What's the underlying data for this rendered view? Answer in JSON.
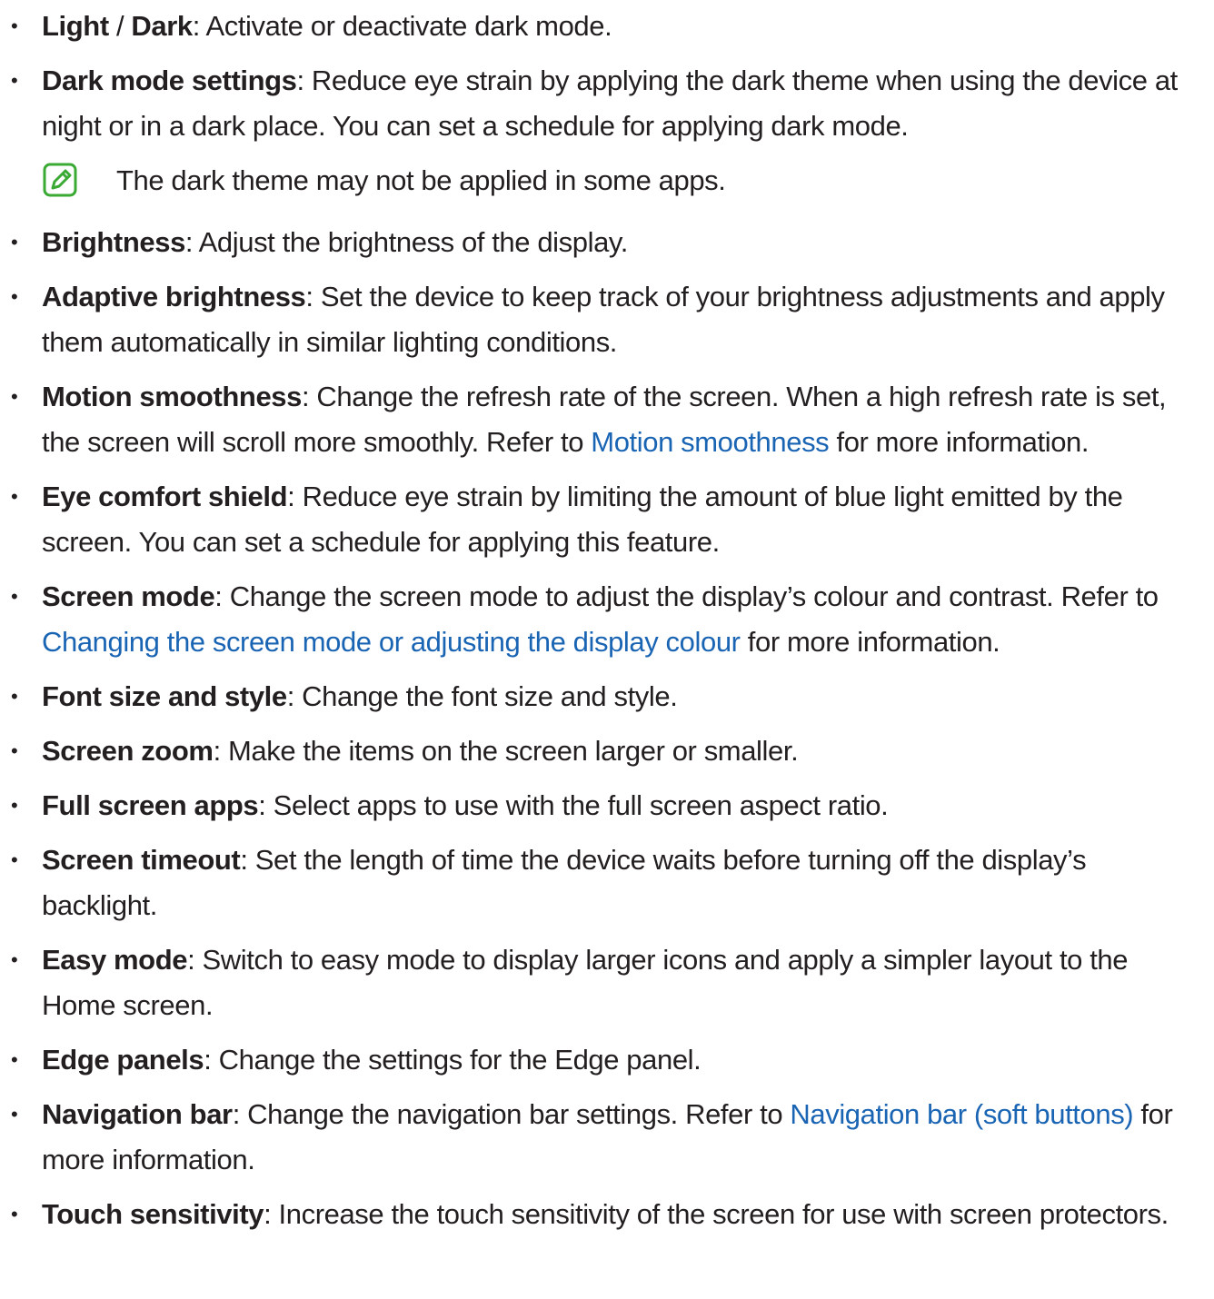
{
  "items": [
    {
      "parts": [
        {
          "b": "Light"
        },
        {
          "t": " / "
        },
        {
          "b": "Dark"
        },
        {
          "t": ": Activate or deactivate dark mode."
        }
      ]
    },
    {
      "parts": [
        {
          "b": "Dark mode settings"
        },
        {
          "t": ": Reduce eye strain by applying the dark theme when using the device at night or in a dark place. You can set a schedule for applying dark mode."
        }
      ]
    },
    {
      "parts": [
        {
          "b": "Brightness"
        },
        {
          "t": ": Adjust the brightness of the display."
        }
      ]
    },
    {
      "parts": [
        {
          "b": "Adaptive brightness"
        },
        {
          "t": ": Set the device to keep track of your brightness adjustments and apply them automatically in similar lighting conditions."
        }
      ]
    },
    {
      "parts": [
        {
          "b": "Motion smoothness"
        },
        {
          "t": ": Change the refresh rate of the screen. When a high refresh rate is set, the screen will scroll more smoothly. Refer to "
        },
        {
          "l": "Motion smoothness"
        },
        {
          "t": " for more information."
        }
      ]
    },
    {
      "parts": [
        {
          "b": "Eye comfort shield"
        },
        {
          "t": ": Reduce eye strain by limiting the amount of blue light emitted by the screen. You can set a schedule for applying this feature."
        }
      ]
    },
    {
      "parts": [
        {
          "b": "Screen mode"
        },
        {
          "t": ": Change the screen mode to adjust the display’s colour and contrast. Refer to "
        },
        {
          "l": "Changing the screen mode or adjusting the display colour"
        },
        {
          "t": " for more information."
        }
      ]
    },
    {
      "parts": [
        {
          "b": "Font size and style"
        },
        {
          "t": ": Change the font size and style."
        }
      ]
    },
    {
      "parts": [
        {
          "b": "Screen zoom"
        },
        {
          "t": ": Make the items on the screen larger or smaller."
        }
      ]
    },
    {
      "parts": [
        {
          "b": "Full screen apps"
        },
        {
          "t": ": Select apps to use with the full screen aspect ratio."
        }
      ]
    },
    {
      "parts": [
        {
          "b": "Screen timeout"
        },
        {
          "t": ": Set the length of time the device waits before turning off the display’s backlight."
        }
      ]
    },
    {
      "parts": [
        {
          "b": "Easy mode"
        },
        {
          "t": ": Switch to easy mode to display larger icons and apply a simpler layout to the Home screen."
        }
      ]
    },
    {
      "parts": [
        {
          "b": "Edge panels"
        },
        {
          "t": ": Change the settings for the Edge panel."
        }
      ]
    },
    {
      "parts": [
        {
          "b": "Navigation bar"
        },
        {
          "t": ": Change the navigation bar settings. Refer to "
        },
        {
          "l": "Navigation bar (soft buttons)"
        },
        {
          "t": " for more information."
        }
      ]
    },
    {
      "parts": [
        {
          "b": "Touch sensitivity"
        },
        {
          "t": ": Increase the touch sensitivity of the screen for use with screen protectors."
        }
      ]
    }
  ],
  "note": {
    "after_item": 1,
    "text": "The dark theme may not be applied in some apps.",
    "icon": "note-pencil-icon",
    "icon_color": "#3aaa35"
  },
  "colors": {
    "link": "#1a64b4",
    "text": "#231f20"
  }
}
